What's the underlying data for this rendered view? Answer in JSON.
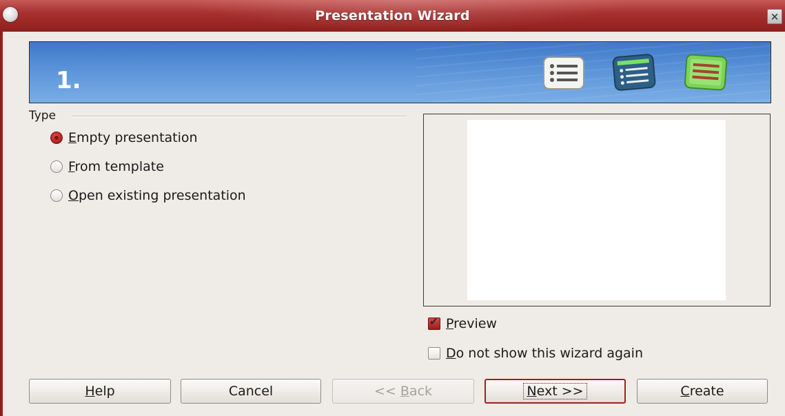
{
  "window": {
    "title": "Presentation Wizard",
    "close_glyph": "×"
  },
  "banner": {
    "step": "1.",
    "icons": [
      "list-icon",
      "list-highlight-icon",
      "list-green-icon"
    ]
  },
  "type_group": {
    "label": "Type",
    "options": [
      {
        "mnemonic": "E",
        "rest": "mpty presentation",
        "checked": true
      },
      {
        "mnemonic": "F",
        "rest": "rom template",
        "checked": false
      },
      {
        "mnemonic": "O",
        "rest": "pen existing presentation",
        "checked": false
      }
    ]
  },
  "preview": {
    "checkbox": {
      "mnemonic": "P",
      "rest": "review",
      "checked": true
    },
    "dont_show": {
      "mnemonic": "D",
      "rest": "o not show this wizard again",
      "checked": false
    }
  },
  "buttons": {
    "help": {
      "mnemonic": "H",
      "rest": "elp"
    },
    "cancel": {
      "label": "Cancel"
    },
    "back": {
      "pre": "<< ",
      "mnemonic": "B",
      "rest": "ack",
      "enabled": false
    },
    "next": {
      "mnemonic": "N",
      "rest": "ext >>",
      "default": true
    },
    "create": {
      "mnemonic": "C",
      "rest": "reate"
    }
  },
  "colors": {
    "titlebar": "#a8312f",
    "banner": "#5a93d8",
    "dialog_bg": "#efebe7",
    "accent_red": "#a0201c"
  }
}
